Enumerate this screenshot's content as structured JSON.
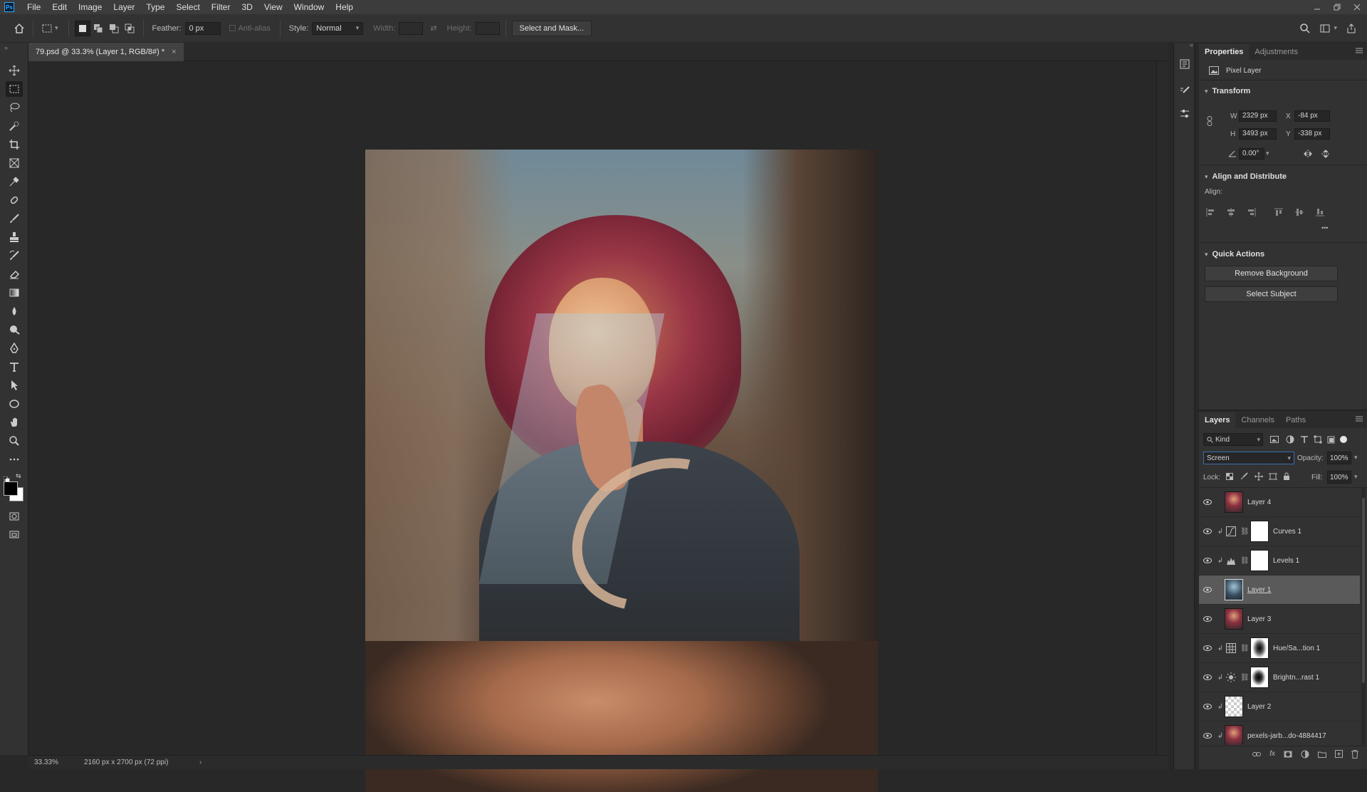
{
  "app": {
    "logo": "Ps",
    "menu": [
      "File",
      "Edit",
      "Image",
      "Layer",
      "Type",
      "Select",
      "Filter",
      "3D",
      "View",
      "Window",
      "Help"
    ]
  },
  "options": {
    "feather_label": "Feather:",
    "feather_value": "0 px",
    "anti_alias_label": "Anti-alias",
    "style_label": "Style:",
    "style_value": "Normal",
    "width_label": "Width:",
    "height_label": "Height:",
    "select_and_mask": "Select and Mask..."
  },
  "document": {
    "tab_title": "79.psd @ 33.3% (Layer 1, RGB/8#) *",
    "close_glyph": "×"
  },
  "status": {
    "zoom": "33.33%",
    "doc_size": "2160 px x 2700 px (72 ppi)",
    "arrow": "›"
  },
  "properties": {
    "tabs": [
      "Properties",
      "Adjustments"
    ],
    "kind": "Pixel Layer",
    "transform_title": "Transform",
    "w_label": "W",
    "w_value": "2329 px",
    "h_label": "H",
    "h_value": "3493 px",
    "x_label": "X",
    "x_value": "-84 px",
    "y_label": "Y",
    "y_value": "-338 px",
    "angle_value": "0.00°",
    "align_title": "Align and Distribute",
    "align_label": "Align:",
    "more": "•••",
    "quick_title": "Quick Actions",
    "remove_bg": "Remove Background",
    "select_subject": "Select Subject"
  },
  "layers_panel": {
    "tabs": [
      "Layers",
      "Channels",
      "Paths"
    ],
    "filter_kind": "Kind",
    "blend_mode": "Screen",
    "opacity_label": "Opacity:",
    "opacity_value": "100%",
    "lock_label": "Lock:",
    "fill_label": "Fill:",
    "fill_value": "100%",
    "layers": [
      {
        "name": "Layer 4"
      },
      {
        "name": "Curves 1"
      },
      {
        "name": "Levels 1"
      },
      {
        "name": "Layer 1"
      },
      {
        "name": "Layer 3"
      },
      {
        "name": "Hue/Sa...tion 1"
      },
      {
        "name": "Brightn...rast 1"
      },
      {
        "name": "Layer 2"
      },
      {
        "name": "pexels-jarb...do-4884417"
      }
    ]
  }
}
